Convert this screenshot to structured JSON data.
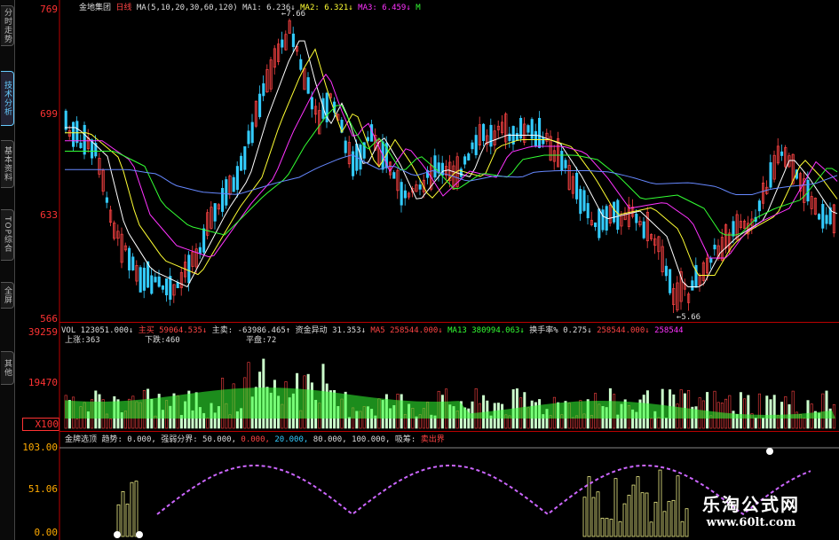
{
  "sidebar": {
    "tabs": [
      {
        "label": "分时走势",
        "active": false
      },
      {
        "label": "技术分析",
        "active": true
      },
      {
        "label": "基本资料",
        "active": false
      },
      {
        "label": "TOP综合",
        "active": false
      },
      {
        "label": "全屏",
        "active": false
      },
      {
        "label": "其他",
        "active": false
      }
    ]
  },
  "main": {
    "stock_name": "金地集团",
    "period": "日线",
    "ma_params": "MA(5,10,20,30,60,120)",
    "ma1": "MA1: 6.236↓",
    "ma2": "MA2: 6.321↓",
    "ma3": "MA3: 6.459↓",
    "ma_tail": "M",
    "high_marker": "←7.66",
    "low_marker": "←5.66",
    "y_labels": [
      "769",
      "699",
      "633",
      "566"
    ]
  },
  "volume": {
    "header_vol": "VOL 123051.000↓",
    "zhumai_label": "主买",
    "zhumai_value": "59064.535↓",
    "zhumai2_label": "主卖:",
    "zhumai2_value": "-63986.465↑",
    "fund_label": "资金异动",
    "fund_value": "31.353↓",
    "ma5_label": "MA5",
    "ma5_value": "258544.000↓",
    "ma13_label": "MA13",
    "ma13_value": "380994.063↓",
    "turnover_label": "换手率%",
    "turnover_value": "0.275↓",
    "tail_value": "258544.000↓",
    "tail2_value": "258544",
    "up_label": "上涨:363",
    "down_label": "下跌:460",
    "flat_label": "平盘:72",
    "y_labels": [
      "39259",
      "19470",
      "X100"
    ]
  },
  "indicator": {
    "name": "金牌选顶",
    "trend_label": "趋势: 0.000,",
    "strength_label": "强弱分界: 50.000,",
    "v1": "0.000,",
    "v2": "20.000,",
    "v3": "80.000,",
    "v4": "100.000,",
    "rise_label": "吸筹:",
    "sell_label": "卖出界",
    "y_labels": [
      "103.00",
      "51.06",
      "0.00"
    ]
  },
  "watermark": {
    "line1": "乐淘公式网",
    "line2": "www.60lt.com"
  },
  "colors": {
    "up": "#ff4444",
    "down": "#33ccff",
    "ma1": "#ffffff",
    "ma2": "#ffff33",
    "ma3": "#ff33ff",
    "ma4": "#33ff33",
    "ma5": "#6688ff",
    "volume_fill": "#33ff33",
    "volume_spike": "#ff3333"
  }
}
